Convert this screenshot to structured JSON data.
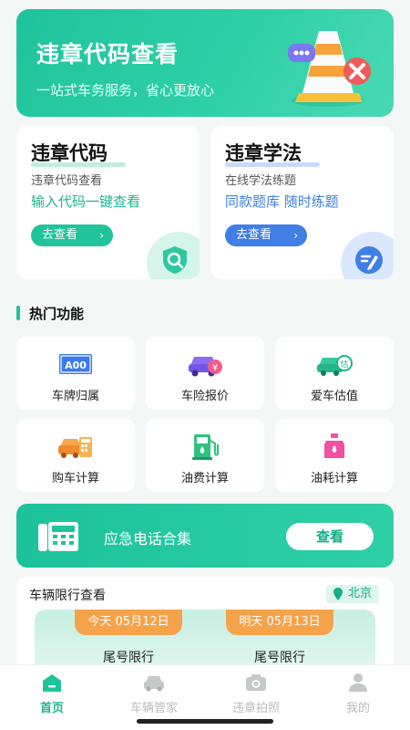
{
  "hero": {
    "title": "违章代码查看",
    "subtitle": "一站式车务服务，省心更放心"
  },
  "cards": [
    {
      "title": "违章代码",
      "subtitle": "违章代码查看",
      "desc": "输入代码一键查看",
      "button": "去查看",
      "accent": "#21c39b",
      "icon": "shield-search-icon"
    },
    {
      "title": "违章学法",
      "subtitle": "在线学法练题",
      "desc": "同款题库 随时练题",
      "button": "去查看",
      "accent": "#3f7fe6",
      "icon": "pen-note-icon"
    }
  ],
  "hot": {
    "title": "热门功能",
    "items": [
      {
        "label": "车牌归属",
        "icon": "license-plate-icon"
      },
      {
        "label": "车险报价",
        "icon": "car-insurance-icon"
      },
      {
        "label": "爱车估值",
        "icon": "car-valuation-icon"
      },
      {
        "label": "购车计算",
        "icon": "car-calculator-icon"
      },
      {
        "label": "油费计算",
        "icon": "fuel-pump-icon"
      },
      {
        "label": "油耗计算",
        "icon": "oil-bottle-icon"
      }
    ]
  },
  "emergency": {
    "label": "应急电话合集",
    "button": "查看"
  },
  "limit": {
    "title": "车辆限行查看",
    "city": "北京",
    "today_tag": "今天 05月12日",
    "tomorrow_tag": "明天 05月13日",
    "today_label": "尾号限行",
    "tomorrow_label": "尾号限行"
  },
  "tabs": [
    {
      "label": "首页",
      "icon": "home-icon",
      "active": true
    },
    {
      "label": "车辆管家",
      "icon": "car-icon",
      "active": false
    },
    {
      "label": "违章拍照",
      "icon": "camera-icon",
      "active": false
    },
    {
      "label": "我的",
      "icon": "user-icon",
      "active": false
    }
  ],
  "colors": {
    "brand": "#1fc39b",
    "blue": "#3f7fe6",
    "orange": "#f5a34b"
  }
}
